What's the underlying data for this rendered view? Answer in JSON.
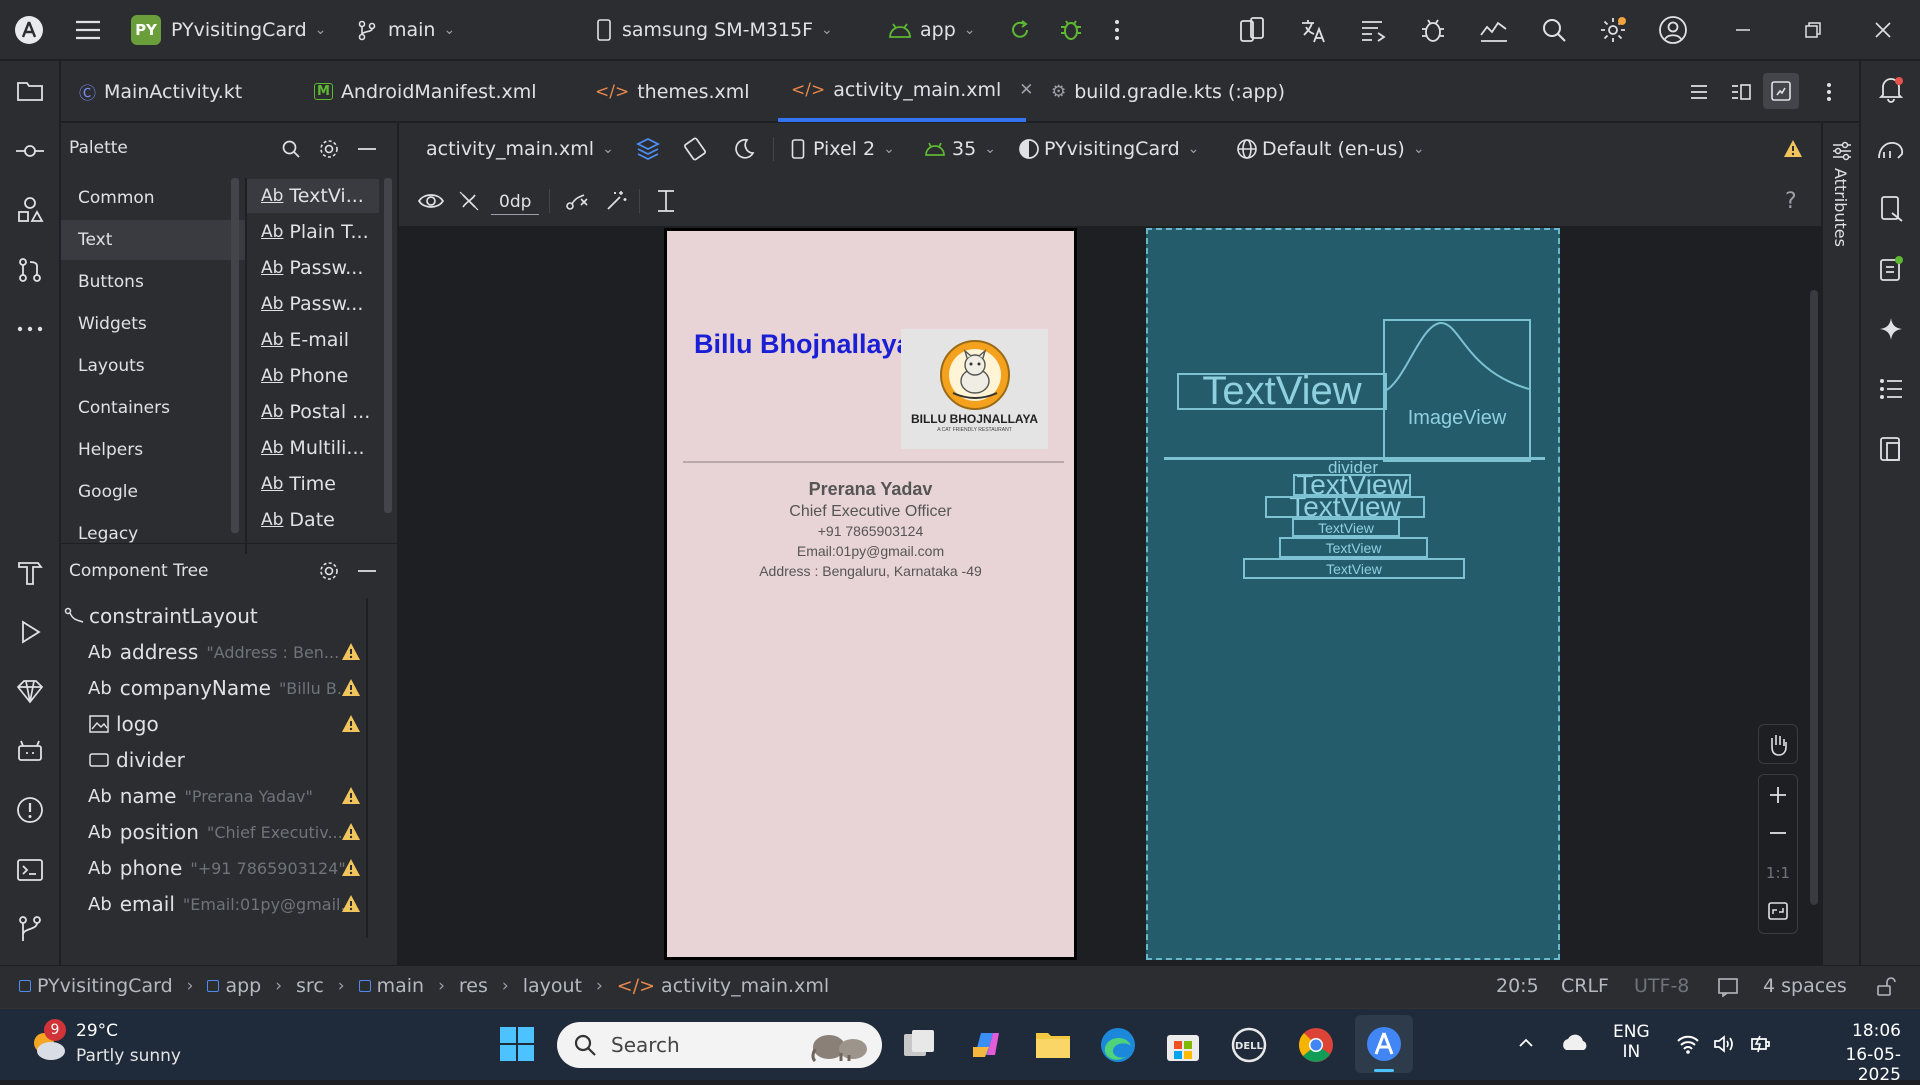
{
  "titlebar": {
    "project_badge": "PY",
    "project_name": "PYvisitingCard",
    "branch": "main",
    "device": "samsung SM-M315F",
    "run_config": "app"
  },
  "tabs": [
    {
      "label": "MainActivity.kt"
    },
    {
      "label": "AndroidManifest.xml"
    },
    {
      "label": "themes.xml"
    },
    {
      "label": "activity_main.xml"
    },
    {
      "label": "build.gradle.kts (:app)"
    }
  ],
  "palette": {
    "title": "Palette",
    "categories": [
      "Common",
      "Text",
      "Buttons",
      "Widgets",
      "Layouts",
      "Containers",
      "Helpers",
      "Google",
      "Legacy"
    ],
    "items": [
      "TextVi...",
      "Plain T...",
      "Passw...",
      "Passw...",
      "E-mail",
      "Phone",
      "Postal ...",
      "Multili...",
      "Time",
      "Date"
    ],
    "ab": "Ab"
  },
  "component_tree": {
    "title": "Component Tree",
    "root": "constraintLayout",
    "nodes": [
      {
        "kind": "Ab",
        "name": "address",
        "hint": "\"Address : Ben...",
        "warn": true
      },
      {
        "kind": "Ab",
        "name": "companyName",
        "hint": "\"Billu B...",
        "warn": true
      },
      {
        "kind": "img",
        "name": "logo",
        "hint": "",
        "warn": true
      },
      {
        "kind": "view",
        "name": "divider",
        "hint": "",
        "warn": false
      },
      {
        "kind": "Ab",
        "name": "name",
        "hint": "\"Prerana Yadav\"",
        "warn": true
      },
      {
        "kind": "Ab",
        "name": "position",
        "hint": "\"Chief Executiv...",
        "warn": true
      },
      {
        "kind": "Ab",
        "name": "phone",
        "hint": "\"+91 7865903124\"",
        "warn": true
      },
      {
        "kind": "Ab",
        "name": "email",
        "hint": "\"Email:01py@gmail...",
        "warn": true
      }
    ]
  },
  "editor": {
    "file": "activity_main.xml",
    "device": "Pixel 2",
    "api": "35",
    "theme": "PYvisitingCard",
    "locale": "Default (en-us)",
    "margin": "0dp",
    "help": "?"
  },
  "preview": {
    "company": "Billu Bhojnallaya",
    "logo_title": "BILLU BHOJNALLAYA",
    "logo_subtitle": "A CAT FRIENDLY RESTAURANT",
    "name": "Prerana Yadav",
    "position": "Chief Executive Officer",
    "phone": "+91 7865903124",
    "email": "Email:01py@gmail.com",
    "address": "Address : Bengaluru, Karnataka -49"
  },
  "blueprint": {
    "textview": "TextView",
    "imageview": "ImageView",
    "divider": "divider"
  },
  "zoom": {
    "ratio": "1:1"
  },
  "attributes_label": "Attributes",
  "breadcrumb": [
    "PYvisitingCard",
    "app",
    "src",
    "main",
    "res",
    "layout",
    "activity_main.xml"
  ],
  "status": {
    "position": "20:5",
    "line_ending": "CRLF",
    "encoding": "UTF-8",
    "indent": "4 spaces"
  },
  "taskbar": {
    "weather_badge": "9",
    "temperature": "29°C",
    "condition": "Partly sunny",
    "search_placeholder": "Search",
    "lang1": "ENG",
    "lang2": "IN",
    "time": "18:06",
    "date": "16-05-2025"
  },
  "colors": {
    "accent": "#3574f0",
    "warning": "#f2c55c",
    "company_text": "#1a1fd6",
    "blueprint": "#245c6c"
  }
}
